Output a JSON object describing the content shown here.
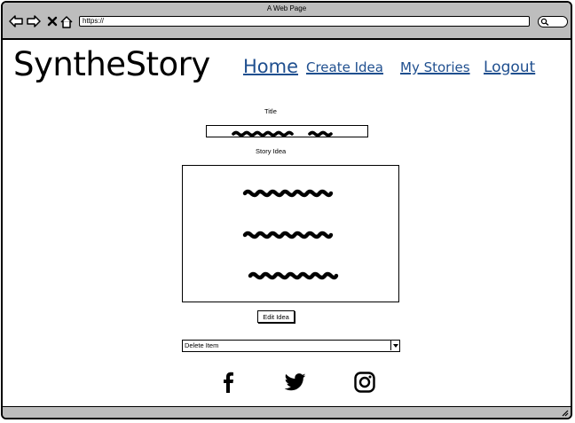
{
  "window": {
    "title": "A Web Page"
  },
  "browser": {
    "url": "https://"
  },
  "header": {
    "logo": "SyntheStory",
    "nav": {
      "home": "Home",
      "create": "Create Idea",
      "stories": "My Stories",
      "logout": "Logout"
    }
  },
  "form": {
    "title_label": "Title",
    "story_label": "Story Idea",
    "edit_button": "Edit Idea",
    "select_value": "Delete Item"
  },
  "social": [
    "facebook-icon",
    "twitter-icon",
    "instagram-icon"
  ],
  "colors": {
    "link": "#1f4f8f",
    "chrome": "#bdbdbd"
  }
}
